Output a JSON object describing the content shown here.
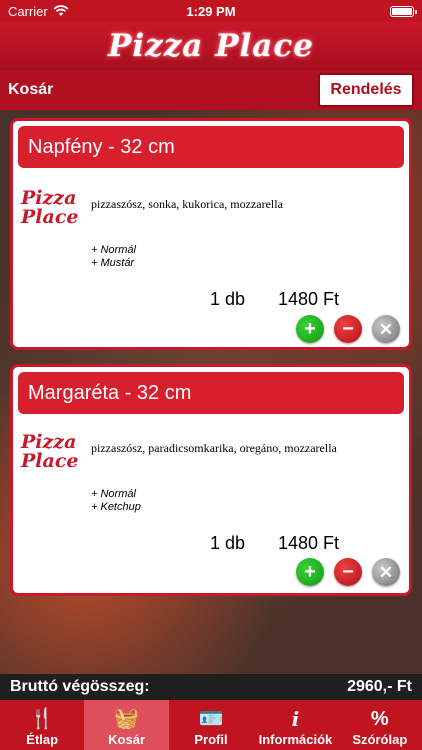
{
  "status": {
    "carrier": "Carrier",
    "time": "1:29 PM"
  },
  "header": {
    "title": "Pizza Place"
  },
  "toolbar": {
    "title": "Kosár",
    "order_label": "Rendelés"
  },
  "cart": {
    "items": [
      {
        "name": "Napfény - 32 cm",
        "logo": "Pizza Place",
        "ingredients": "pizzaszósz, sonka, kukorica, mozzarella",
        "options": [
          "+ Normál",
          "+ Mustár"
        ],
        "quantity": "1 db",
        "price": "1480 Ft"
      },
      {
        "name": "Margaréta - 32 cm",
        "logo": "Pizza Place",
        "ingredients": "pizzaszósz, paradicsomkarika, oregáno, mozzarella",
        "options": [
          "+ Normál",
          "+ Ketchup"
        ],
        "quantity": "1 db",
        "price": "1480 Ft"
      }
    ]
  },
  "footer": {
    "total_label": "Bruttó végösszeg:",
    "total_value": "2960,- Ft"
  },
  "tabs": [
    {
      "label": "Étlap",
      "icon": "fork-knife-icon",
      "glyph": "🍴"
    },
    {
      "label": "Kosár",
      "icon": "basket-icon",
      "glyph": "🧺",
      "active": true
    },
    {
      "label": "Profil",
      "icon": "id-card-icon",
      "glyph": "🪪"
    },
    {
      "label": "Információk",
      "icon": "info-icon",
      "glyph": "i"
    },
    {
      "label": "Szórólap",
      "icon": "percent-icon",
      "glyph": "%"
    }
  ],
  "colors": {
    "brand_red": "#c01421",
    "card_header": "#d81f2e",
    "footer_bg": "#1f1f1f"
  }
}
